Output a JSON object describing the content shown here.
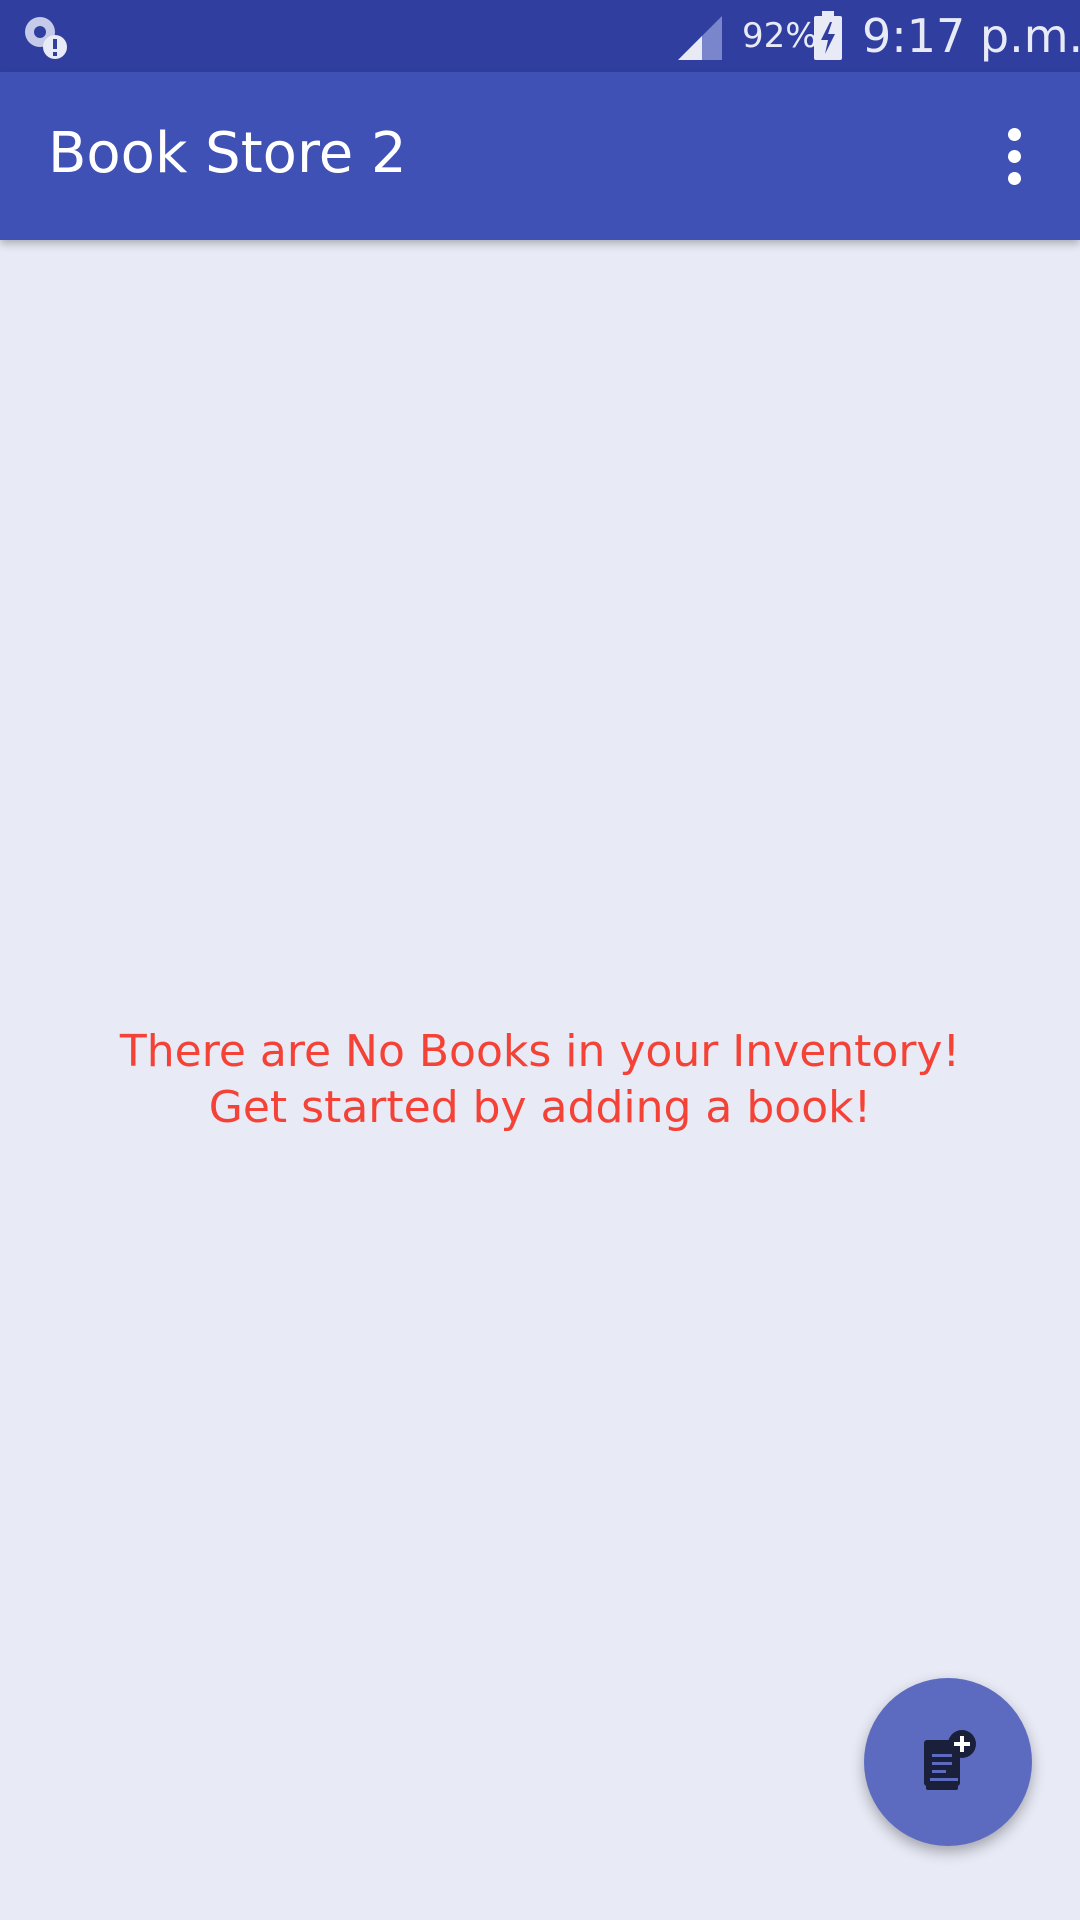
{
  "status_bar": {
    "left_icon": "sync-alert-icon",
    "signal_icon": "cell-signal-icon",
    "battery_percent": "92%",
    "battery_icon": "battery-charging-icon",
    "time": "9:17 p.m."
  },
  "app_bar": {
    "title": "Book Store 2",
    "menu_icon": "more-vert-icon"
  },
  "empty_state": {
    "line1": "There are No Books in your Inventory!",
    "line2": "Get started by adding a book!"
  },
  "fab": {
    "icon": "add-book-icon"
  },
  "colors": {
    "status_bar": "#303f9f",
    "app_bar": "#3f51b5",
    "background": "#e8eaf6",
    "empty_text": "#f44336",
    "fab": "#5c6bc0"
  }
}
